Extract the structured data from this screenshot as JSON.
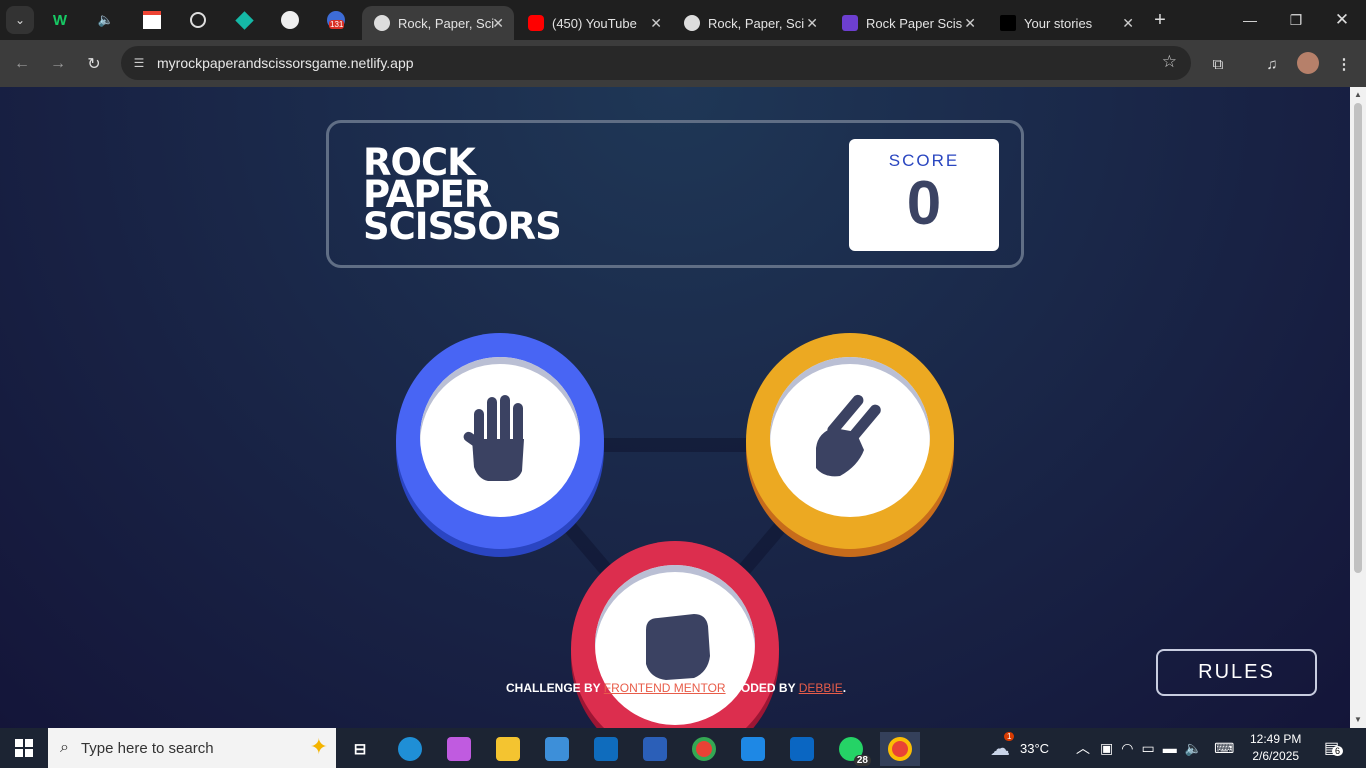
{
  "browser": {
    "tabs": [
      {
        "label": "Rock, Paper, Scissors",
        "active": true
      },
      {
        "label": "(450) YouTube",
        "active": false
      },
      {
        "label": "Rock, Paper, Scissors",
        "active": false
      },
      {
        "label": "Rock Paper Scissors",
        "active": false
      },
      {
        "label": "Your stories",
        "active": false
      }
    ],
    "pinned_badge": "131",
    "url": "myrockpaperandscissorsgame.netlify.app"
  },
  "game": {
    "logo": [
      "ROCK",
      "PAPER",
      "SCISSORS"
    ],
    "score_label": "SCORE",
    "score": "0",
    "choices": [
      "paper",
      "scissors",
      "rock"
    ],
    "rules_label": "RULES",
    "attribution": {
      "prefix": "CHALLENGE BY ",
      "link1": "FRONTEND MENTOR",
      "middle": ". CODED BY ",
      "link2": "DEBBIE",
      "suffix": "."
    },
    "colors": {
      "paper": "#4865f4",
      "scissors": "#eca922",
      "rock": "#dc2e4e",
      "background": "#141539",
      "score_text": "#3b4363"
    }
  },
  "taskbar": {
    "search_placeholder": "Type here to search",
    "whatsapp_badge": "28",
    "weather_alert": "1",
    "temperature": "33°C",
    "time": "12:49 PM",
    "date": "2/6/2025",
    "notifications": "6"
  }
}
